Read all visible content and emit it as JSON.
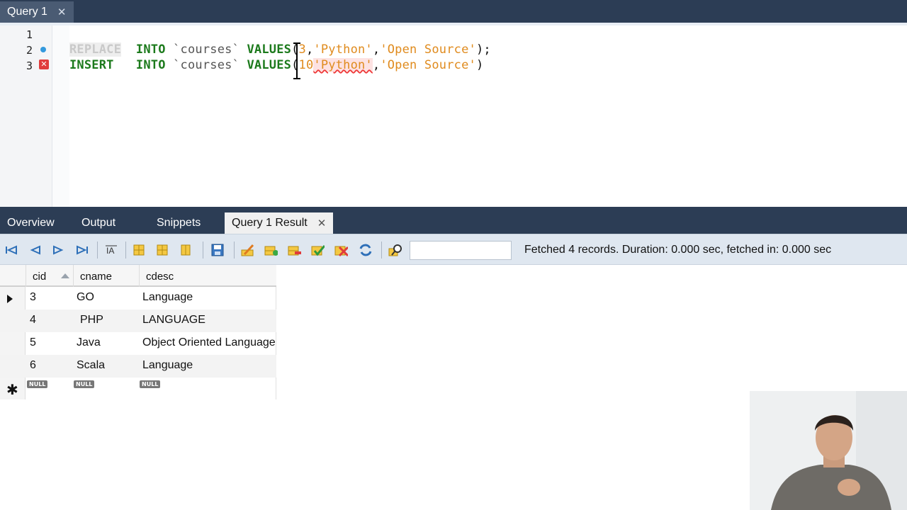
{
  "query_tab": {
    "label": "Query 1",
    "close": "✕"
  },
  "editor": {
    "line_numbers": [
      "1",
      "2",
      "3"
    ],
    "line2": {
      "kw_replace": "REPLACE",
      "kw_into": "INTO",
      "table": "`courses`",
      "kw_values": "VALUES",
      "open": "(",
      "num": "3",
      "comma1": ",",
      "str1": "'Python'",
      "comma2": ",",
      "str2": "'Open Source'",
      "close": ");"
    },
    "line3": {
      "kw_insert": "INSERT",
      "kw_into": "INTO",
      "table": "`courses`",
      "kw_values": "VALUES",
      "open": "(",
      "num": "10",
      "str1": "'Python'",
      "comma2": ",",
      "str2": "'Open Source'",
      "close": ")"
    }
  },
  "result_tabs": {
    "overview": "Overview",
    "output": "Output",
    "snippets": "Snippets",
    "result": "Query 1 Result",
    "close": "✕"
  },
  "toolbar": {
    "icons": [
      "first-record-icon",
      "previous-record-icon",
      "next-record-icon",
      "last-record-icon",
      "wrap-cell-icon",
      "export-icon",
      "import-icon",
      "column-icon",
      "save-icon",
      "edit-icon",
      "add-row-icon",
      "delete-row-icon",
      "apply-icon",
      "discard-icon",
      "refresh-icon",
      "search-icon"
    ],
    "search_value": "",
    "status": "Fetched 4 records. Duration: 0.000 sec, fetched in: 0.000 sec"
  },
  "grid": {
    "columns": [
      "cid",
      "cname",
      "cdesc"
    ],
    "rows": [
      {
        "cid": "3",
        "cname": "GO",
        "cdesc": "Language"
      },
      {
        "cid": "4",
        "cname": "PHP",
        "cdesc": "LANGUAGE"
      },
      {
        "cid": "5",
        "cname": "Java",
        "cdesc": "Object Oriented Language"
      },
      {
        "cid": "6",
        "cname": "Scala",
        "cdesc": "Language"
      }
    ],
    "new_row_marker": "✱",
    "null_label": "NULL"
  },
  "colors": {
    "dark_bar": "#2c3d55",
    "keyword": "#1c7a1c",
    "string": "#e08b1e",
    "toolbar": "#dfe7f0"
  }
}
